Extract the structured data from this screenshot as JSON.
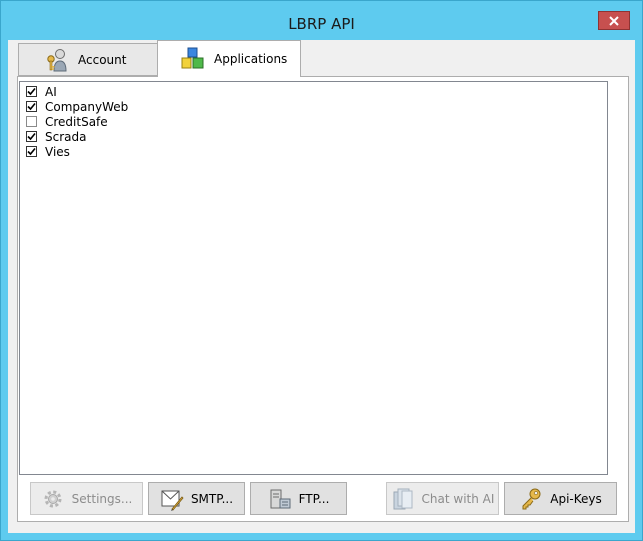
{
  "window": {
    "title": "LBRP API"
  },
  "tabs": [
    {
      "label": "Account",
      "icon": "key-person-icon",
      "active": false
    },
    {
      "label": "Applications",
      "icon": "blocks-icon",
      "active": true
    }
  ],
  "applications": [
    {
      "label": "AI",
      "checked": true
    },
    {
      "label": "CompanyWeb",
      "checked": true
    },
    {
      "label": "CreditSafe",
      "checked": false
    },
    {
      "label": "Scrada",
      "checked": true
    },
    {
      "label": "Vies",
      "checked": true
    }
  ],
  "buttons": {
    "settings": {
      "label": "Settings...",
      "enabled": false,
      "icon": "gear-icon"
    },
    "smtp": {
      "label": "SMTP...",
      "enabled": true,
      "icon": "mail-icon"
    },
    "ftp": {
      "label": "FTP...",
      "enabled": true,
      "icon": "server-icon"
    },
    "chat_ai": {
      "label": "Chat with AI",
      "enabled": false,
      "icon": "document-stack-icon"
    },
    "api_keys": {
      "label": "Api-Keys",
      "enabled": true,
      "icon": "key-icon"
    }
  },
  "colors": {
    "title_bar": "#5ecbef",
    "close_button": "#c7504f"
  }
}
